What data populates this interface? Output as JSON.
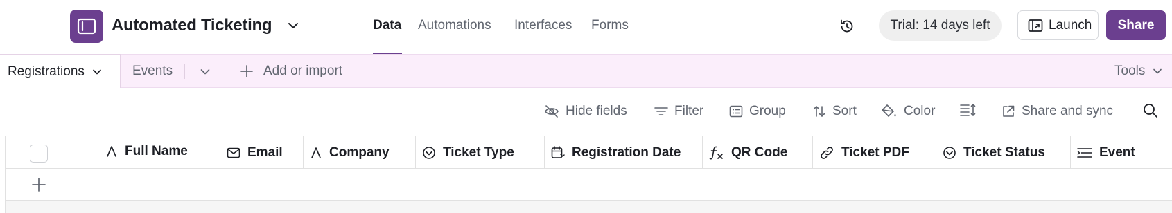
{
  "app": {
    "base_title": "Automated Ticketing",
    "accent_color": "#6b3f8f",
    "tab_bar_color": "#fbeefb"
  },
  "nav": {
    "items": [
      {
        "label": "Data",
        "active": true
      },
      {
        "label": "Automations",
        "active": false
      },
      {
        "label": "Interfaces",
        "active": false
      },
      {
        "label": "Forms",
        "active": false
      }
    ]
  },
  "header_actions": {
    "trial_label": "Trial: 14 days left",
    "launch_label": "Launch",
    "share_label": "Share",
    "history_icon": "history-icon"
  },
  "tables": {
    "tabs": [
      {
        "label": "Registrations",
        "active": true
      },
      {
        "label": "Events",
        "active": false
      }
    ],
    "add_import_label": "Add or import",
    "tools_label": "Tools"
  },
  "view_toolbar": {
    "hide_fields": "Hide fields",
    "filter": "Filter",
    "group": "Group",
    "sort": "Sort",
    "color": "Color",
    "share_sync": "Share and sync"
  },
  "grid": {
    "columns": [
      {
        "label": "Full Name",
        "icon": "text-field-icon"
      },
      {
        "label": "Email",
        "icon": "email-field-icon"
      },
      {
        "label": "Company",
        "icon": "text-field-icon"
      },
      {
        "label": "Ticket Type",
        "icon": "single-select-icon"
      },
      {
        "label": "Registration Date",
        "icon": "calendar-icon"
      },
      {
        "label": "QR Code",
        "icon": "formula-icon"
      },
      {
        "label": "Ticket PDF",
        "icon": "link-icon"
      },
      {
        "label": "Ticket Status",
        "icon": "single-select-icon"
      },
      {
        "label": "Event",
        "icon": "long-text-icon"
      }
    ]
  }
}
